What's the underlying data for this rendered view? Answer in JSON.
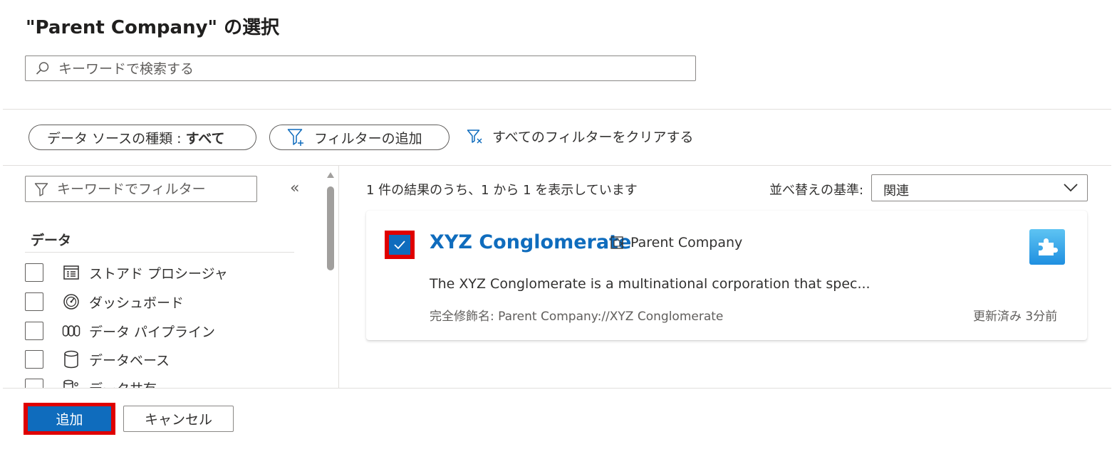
{
  "dialog": {
    "title": "\"Parent Company\" の選択",
    "search_placeholder": "キーワードで検索する"
  },
  "filters": {
    "source_type_label": "データ ソースの種類 : ",
    "source_type_value": "すべて",
    "add_filter": "フィルターの追加",
    "clear_all": "すべてのフィルターをクリアする"
  },
  "sidebar": {
    "filter_placeholder": "キーワードでフィルター",
    "collapse_glyph": "«",
    "section_title": "データ",
    "items": [
      {
        "label": "ストアド プロシージャ",
        "icon": "stored-procedure-icon",
        "checked": false
      },
      {
        "label": "ダッシュボード",
        "icon": "dashboard-gauge-icon",
        "checked": false
      },
      {
        "label": "データ パイプライン",
        "icon": "pipeline-icon",
        "checked": false
      },
      {
        "label": "データベース",
        "icon": "database-icon",
        "checked": false
      },
      {
        "label": "データ共有",
        "icon": "data-share-icon",
        "checked": false
      }
    ]
  },
  "results": {
    "summary": "1 件の結果のうち、1 から 1 を表示しています",
    "sort_label": "並べ替えの基準:",
    "sort_value": "関連",
    "cards": [
      {
        "name": "XYZ Conglomerate",
        "type": "Parent Company",
        "description": "The XYZ Conglomerate is a multinational corporation that spec...",
        "qualified_name": "完全修飾名: Parent Company://XYZ Conglomerate",
        "updated": "更新済み 3分前",
        "checked": true
      }
    ]
  },
  "footer": {
    "add": "追加",
    "cancel": "キャンセル"
  },
  "colors": {
    "accent": "#0f6cbd",
    "highlight": "#e00000"
  }
}
